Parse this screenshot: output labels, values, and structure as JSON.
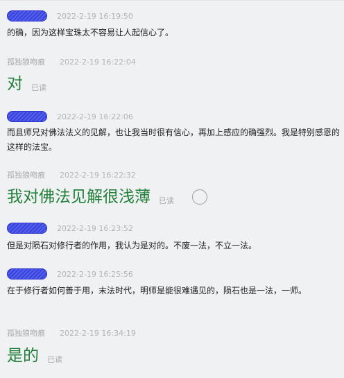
{
  "messages": [
    {
      "sender": "",
      "time": "2022-2-19 16:19:50",
      "text": "的确，因为这样宝珠太不容易让人起信心了。"
    },
    {
      "sender": "孤独狼吻痕",
      "time": "2022-2-19 16:22:04",
      "text": "对",
      "status": "已读"
    },
    {
      "sender": "",
      "time": "2022-2-19 16:22:06",
      "text": "而且师兄对佛法法义的见解，也让我当时很有信心，再加上感应的确强烈。我是特别感恩的这样的法宝。"
    },
    {
      "sender": "孤独狼吻痕",
      "time": "2022-2-19 16:22:32",
      "text": "我对佛法见解很浅薄",
      "status": "已读"
    },
    {
      "sender": "",
      "time": "2022-2-19 16:23:52",
      "text": "但是对陨石对修行者的作用，我认为是对的。不废一法，不立一法。"
    },
    {
      "sender": "",
      "time": "2022-2-19 16:25:56",
      "text": "在于修行者如何善于用，末法时代，明师是能很难遇见的，陨石也是一法，一师。"
    },
    {
      "sender": "孤独狼吻痕",
      "time": "2022-2-19 16:34:19",
      "text": "是的",
      "status": "已读"
    }
  ],
  "colors": {
    "background": "#f0f1f3",
    "sent_text": "#23803a",
    "received_text": "#1f1f1f",
    "meta_text": "#b3b3b3",
    "redaction": "#3a43d8"
  },
  "icons": {
    "message_action": "circle-outline-icon"
  }
}
